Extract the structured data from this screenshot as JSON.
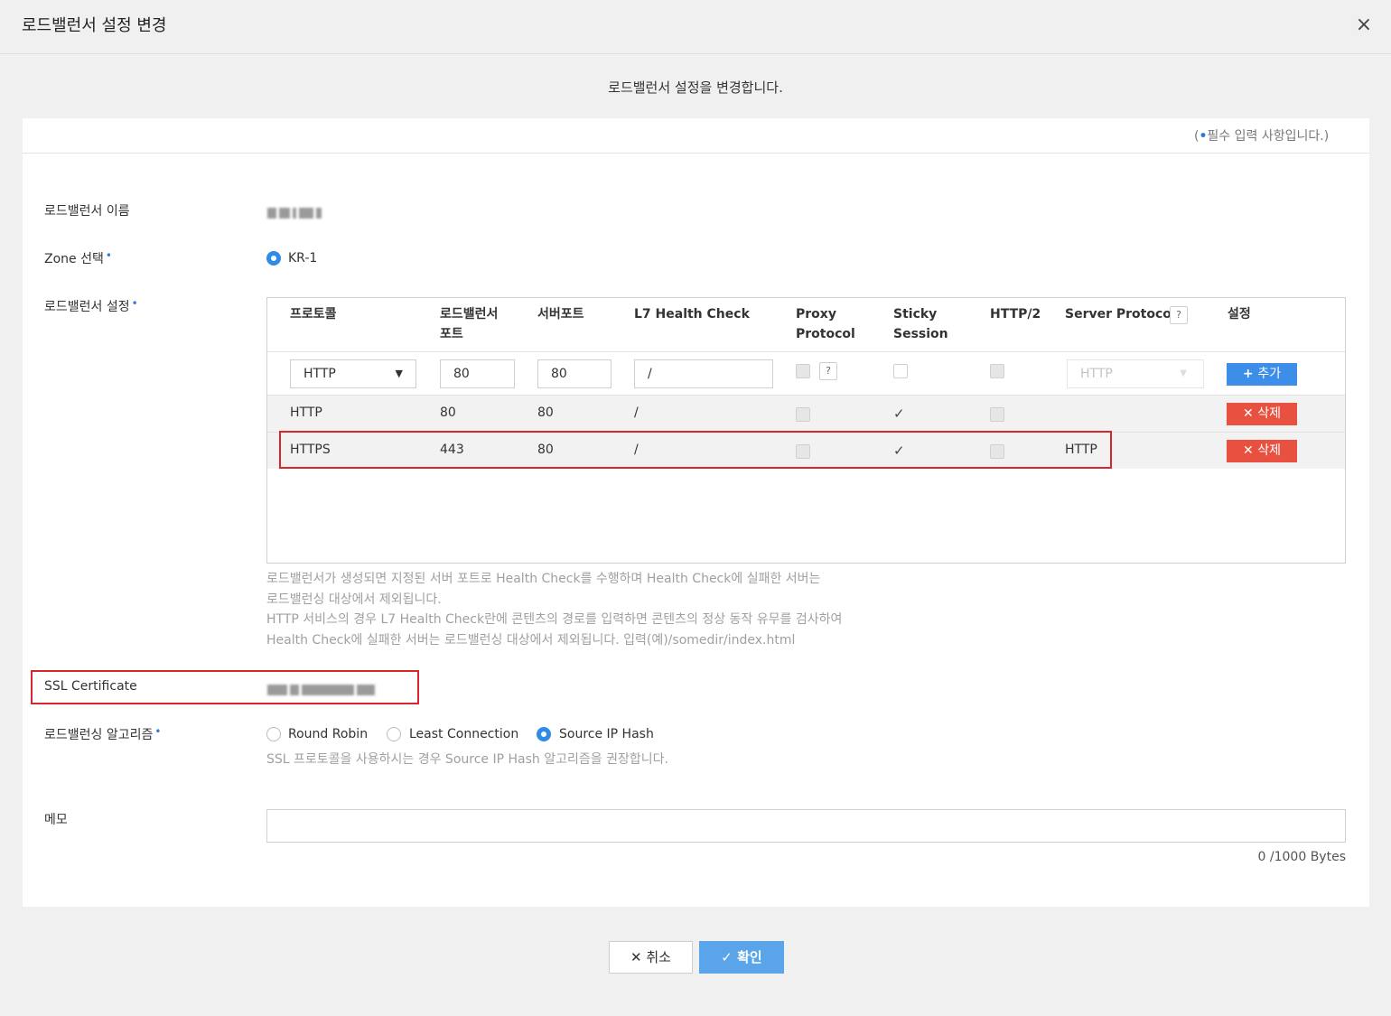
{
  "dialog": {
    "title": "로드밸런서 설정 변경",
    "close_icon": "×",
    "description": "로드밸런서 설정을 변경합니다."
  },
  "required_note": {
    "open": "(",
    "dot": "•",
    "text": "필수 입력 사항입니다.)"
  },
  "fields": {
    "name_label": "로드밸런서 이름",
    "zone_label": "Zone 선택",
    "zone_option": "KR-1",
    "lb_settings_label": "로드밸런서 설정",
    "ssl_label": "SSL Certificate",
    "algo_label": "로드밸런싱 알고리즘",
    "memo_label": "메모",
    "required_marker": "•"
  },
  "table": {
    "headers": {
      "protocol": "프로토콜",
      "lb_port_1": "로드밸런서",
      "lb_port_2": "포트",
      "server_port": "서버포트",
      "l7": "L7 Health Check",
      "proxy_1": "Proxy",
      "proxy_2": "Protocol",
      "sticky_1": "Sticky",
      "sticky_2": "Session",
      "http2": "HTTP/2",
      "server_protocol": "Server Protocol",
      "settings": "설정"
    },
    "input_row": {
      "protocol": "HTTP",
      "lb_port": "80",
      "server_port": "80",
      "l7": "/",
      "server_protocol": "HTTP",
      "add_label": "추가"
    },
    "rows": [
      {
        "protocol": "HTTP",
        "lb_port": "80",
        "server_port": "80",
        "l7": "/",
        "sticky": "✓",
        "server_protocol": "",
        "delete_label": "삭제"
      },
      {
        "protocol": "HTTPS",
        "lb_port": "443",
        "server_port": "80",
        "l7": "/",
        "sticky": "✓",
        "server_protocol": "HTTP",
        "delete_label": "삭제"
      }
    ]
  },
  "health_hint": [
    "로드밸런서가 생성되면 지정된 서버 포트로 Health Check를 수행하며 Health Check에 실패한 서버는",
    "로드밸런싱 대상에서 제외됩니다.",
    "HTTP 서비스의 경우 L7 Health Check란에 콘텐츠의 경로를 입력하면 콘텐츠의 정상 동작 유무를 검사하여",
    "Health Check에 실패한 서버는 로드밸런싱 대상에서 제외됩니다. 입력(예)/somedir/index.html"
  ],
  "algorithms": {
    "options": [
      "Round Robin",
      "Least Connection",
      "Source IP Hash"
    ],
    "selected": "Source IP Hash",
    "hint": "SSL 프로토콜을 사용하시는 경우 Source IP Hash 알고리즘을 권장합니다."
  },
  "memo": {
    "bytes": "0 /1000 Bytes"
  },
  "buttons": {
    "cancel": "취소",
    "confirm": "확인"
  },
  "colors": {
    "accent": "#2e8be6",
    "danger": "#e85140",
    "highlight": "#d9262e"
  }
}
